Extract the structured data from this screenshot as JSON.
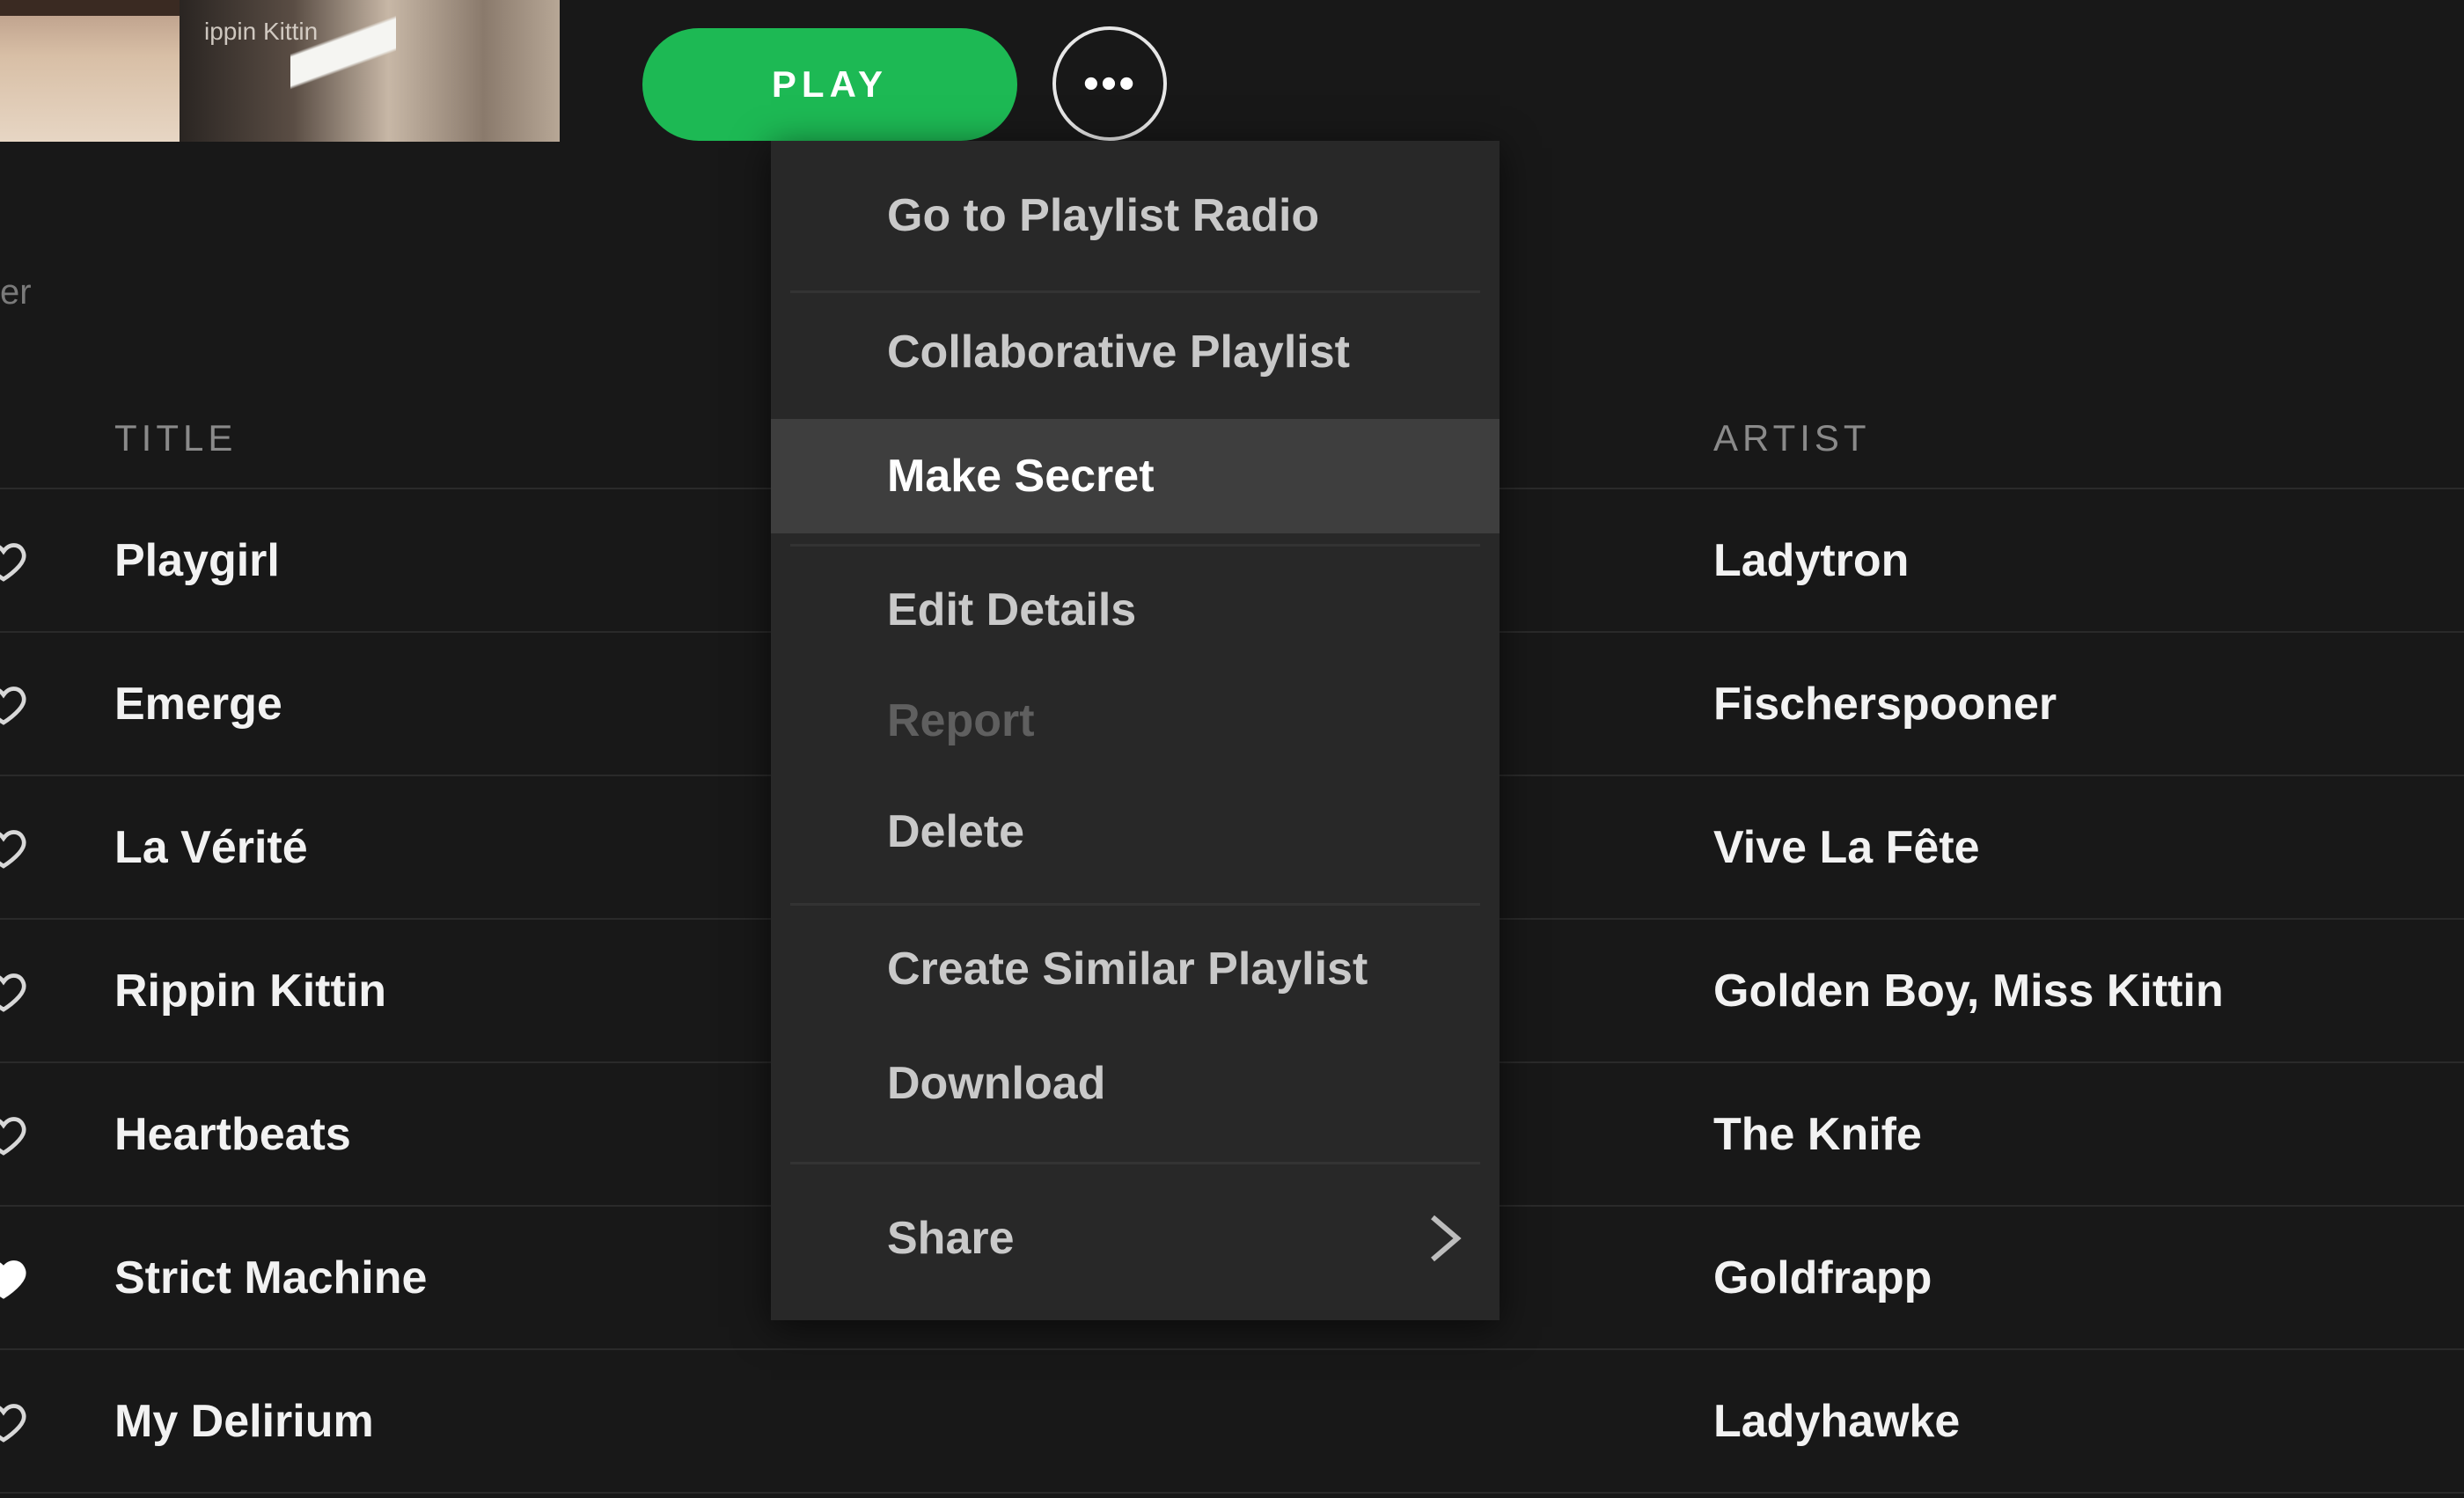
{
  "cover": {
    "caption": "ippin Kittin"
  },
  "actions": {
    "play_label": "PLAY",
    "more_label": "•••"
  },
  "sidebar_fragment": "er",
  "columns": {
    "title": "TITLE",
    "artist": "ARTIST"
  },
  "tracks": [
    {
      "title": "Playgirl",
      "artist": "Ladytron",
      "liked": false
    },
    {
      "title": "Emerge",
      "artist": "Fischerspooner",
      "liked": false
    },
    {
      "title": "La Vérité",
      "artist": "Vive La Fête",
      "liked": false
    },
    {
      "title": "Rippin Kittin",
      "artist": "Golden Boy, Miss Kittin",
      "liked": false
    },
    {
      "title": "Heartbeats",
      "artist": "The Knife",
      "liked": false
    },
    {
      "title": "Strict Machine",
      "artist": "Goldfrapp",
      "liked": true
    },
    {
      "title": "My Delirium",
      "artist": "Ladyhawke",
      "liked": false
    }
  ],
  "context_menu": {
    "items": [
      {
        "label": "Go to Playlist Radio",
        "state": "normal"
      },
      {
        "label": "Collaborative Playlist",
        "state": "normal"
      },
      {
        "label": "Make Secret",
        "state": "highlighted"
      },
      {
        "label": "Edit Details",
        "state": "normal"
      },
      {
        "label": "Report",
        "state": "disabled"
      },
      {
        "label": "Delete",
        "state": "normal"
      },
      {
        "label": "Create Similar Playlist",
        "state": "normal"
      },
      {
        "label": "Download",
        "state": "normal"
      },
      {
        "label": "Share",
        "state": "normal",
        "submenu": true
      }
    ]
  },
  "colors": {
    "background": "#181818",
    "accent": "#1db954",
    "menu_background": "#282828",
    "menu_highlight": "#3e3e3e"
  }
}
